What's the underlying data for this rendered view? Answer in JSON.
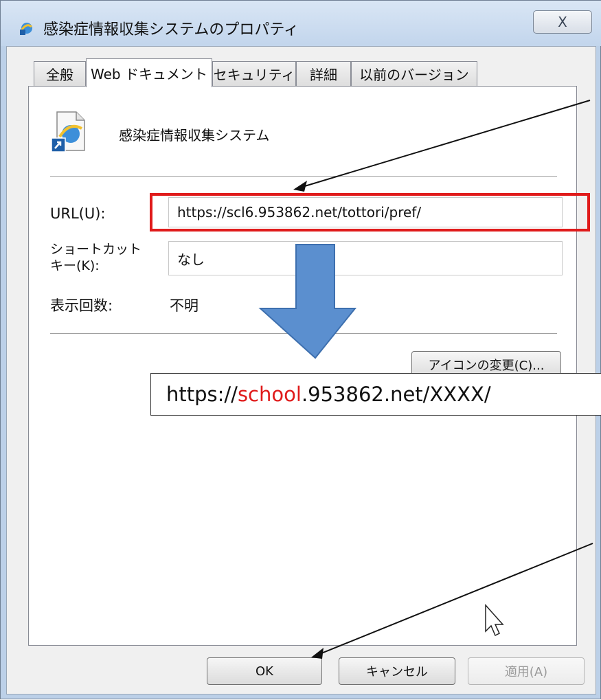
{
  "window": {
    "title": "感染症情報収集システムのプロパティ",
    "close_label": "X"
  },
  "tabs": [
    {
      "label": "全般"
    },
    {
      "label": "Web ドキュメント"
    },
    {
      "label": "セキュリティ"
    },
    {
      "label": "詳細"
    },
    {
      "label": "以前のバージョン"
    }
  ],
  "document": {
    "name": "感染症情報収集システム"
  },
  "fields": {
    "url_label": "URL(U):",
    "url_value": "https://scl6.953862.net/tottori/pref/",
    "shortcut_label_line1": "ショートカット",
    "shortcut_label_line2": "キー(K):",
    "shortcut_value": "なし",
    "visits_label": "表示回数:",
    "visits_value": "不明"
  },
  "buttons": {
    "change_icon": "アイコンの変更(C)...",
    "ok": "OK",
    "cancel": "キャンセル",
    "apply": "適用(A)"
  },
  "annotation": {
    "prefix": "https://",
    "highlight": "school",
    "suffix": ".953862.net/XXXX/",
    "highlight_color": "#e01b1b"
  },
  "colors": {
    "accent_red": "#e01b1b",
    "arrow_blue": "#5b8fcf"
  }
}
